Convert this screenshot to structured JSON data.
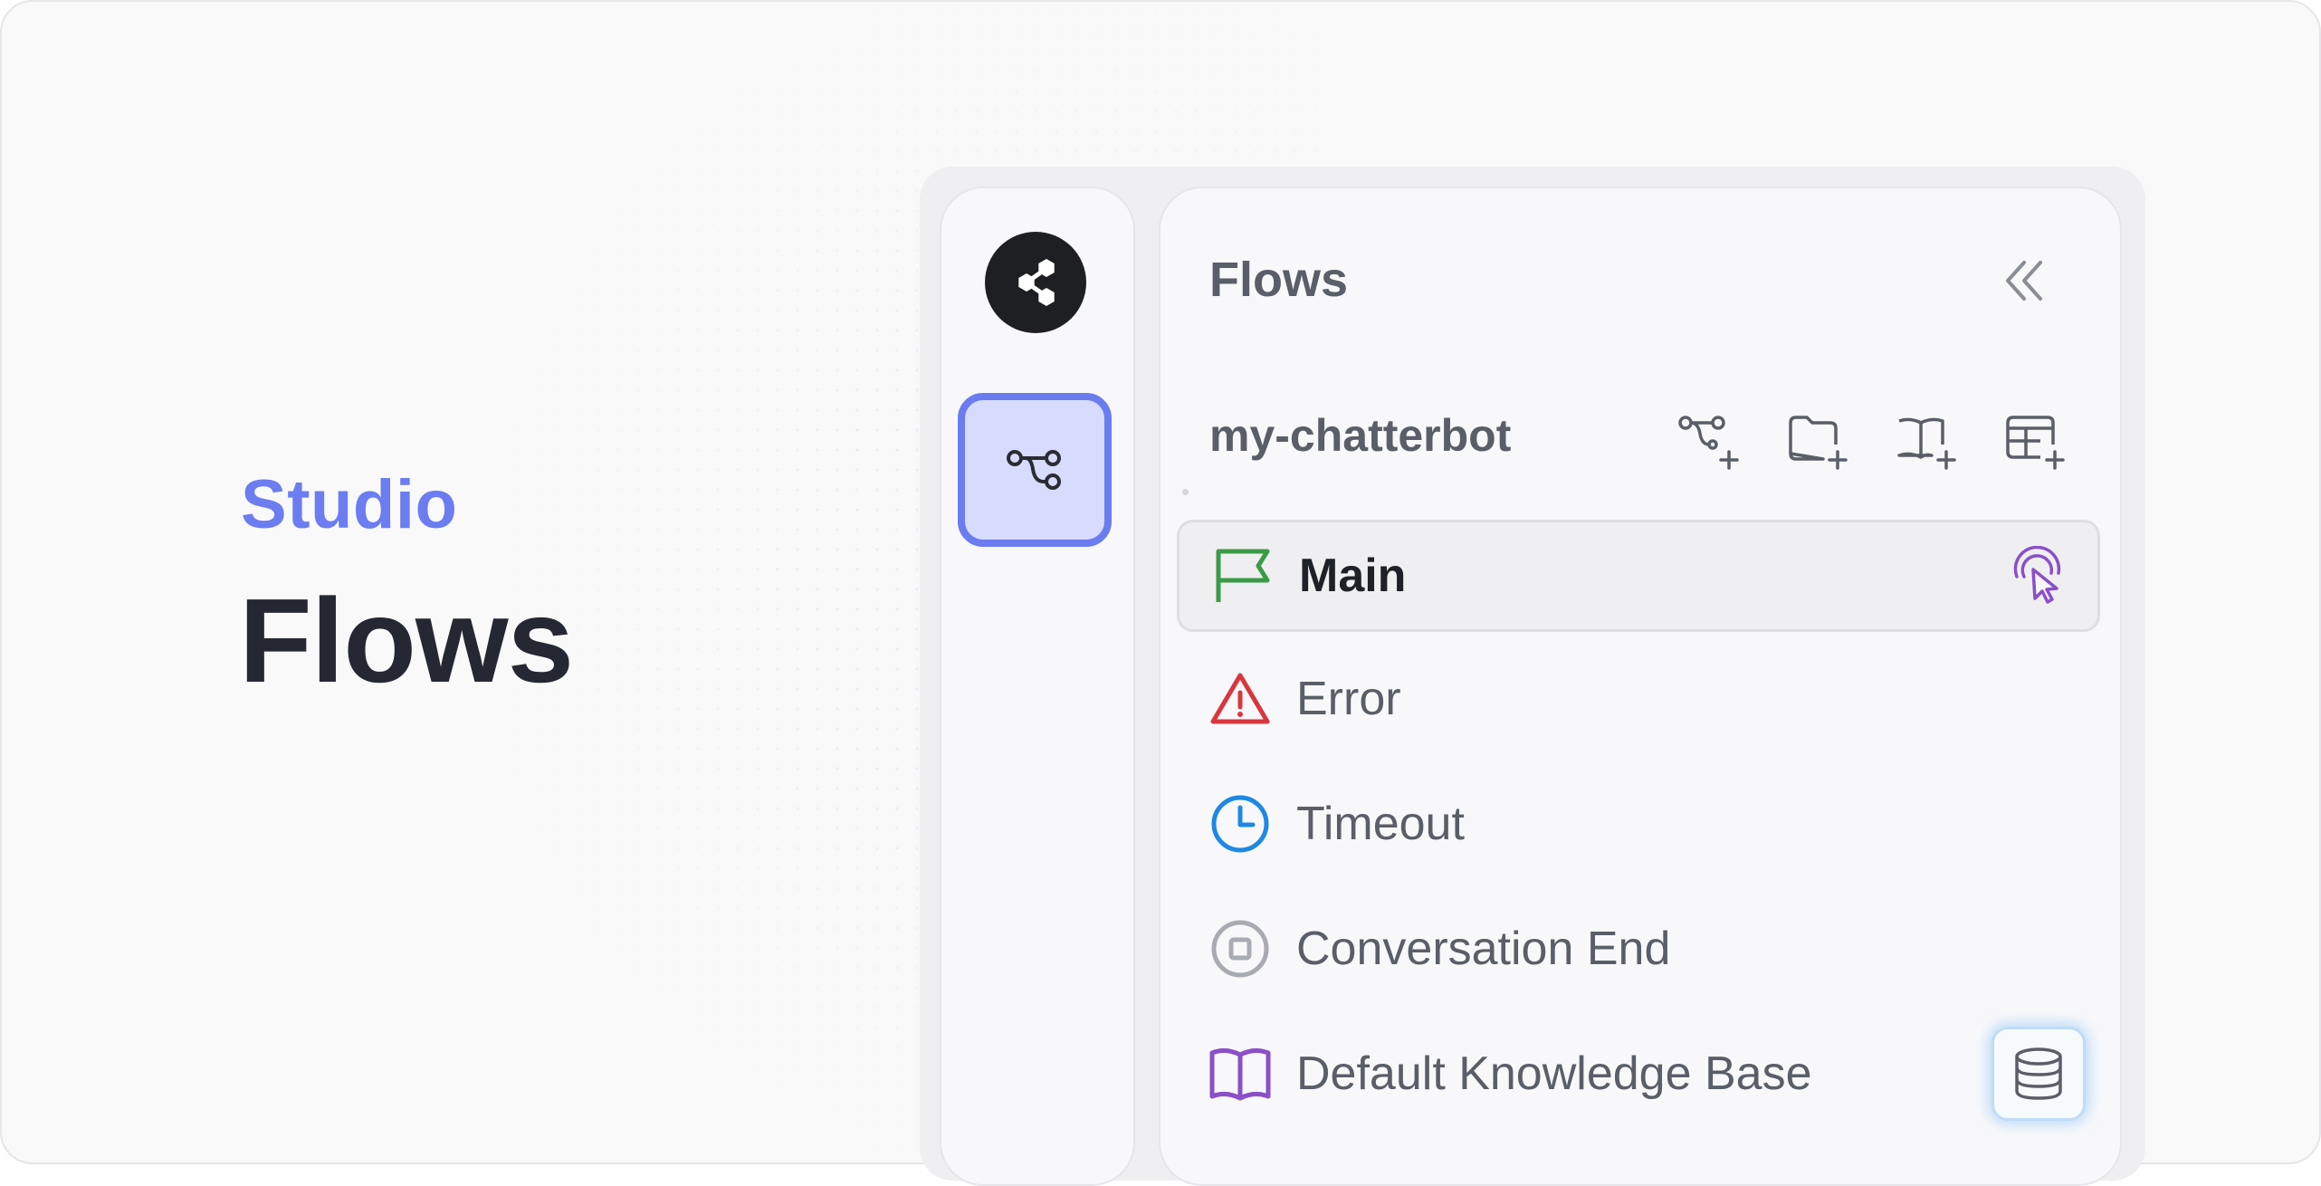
{
  "hero": {
    "eyebrow": "Studio",
    "title": "Flows"
  },
  "rail": {
    "logo_icon": "share-nodes-icon",
    "items": [
      {
        "icon": "flow-branch-icon",
        "active": true
      }
    ]
  },
  "sidebar": {
    "title": "Flows",
    "collapse_icon": "double-chevron-left-icon",
    "project_name": "my-chatterbot",
    "toolbar": [
      {
        "icon": "add-flow-icon"
      },
      {
        "icon": "add-folder-icon"
      },
      {
        "icon": "add-knowledge-base-icon"
      },
      {
        "icon": "add-table-icon"
      }
    ],
    "items": [
      {
        "label": "Main",
        "icon": "flag-icon",
        "icon_color": "#3a9b46",
        "active": true,
        "action_icon": "pointer-click-icon",
        "action_color": "#8b4fc9"
      },
      {
        "label": "Error",
        "icon": "warning-triangle-icon",
        "icon_color": "#d9363e"
      },
      {
        "label": "Timeout",
        "icon": "clock-icon",
        "icon_color": "#1e88e5"
      },
      {
        "label": "Conversation End",
        "icon": "stop-circle-icon",
        "icon_color": "#a9abb3"
      },
      {
        "label": "Default Knowledge Base",
        "icon": "book-open-icon",
        "icon_color": "#8b4fc9",
        "action_icon": "database-icon"
      }
    ]
  },
  "colors": {
    "accent": "#6a7cf0",
    "accent_bg": "#d7dcff",
    "text_dark": "#252832",
    "text_muted": "#5a5e68"
  }
}
